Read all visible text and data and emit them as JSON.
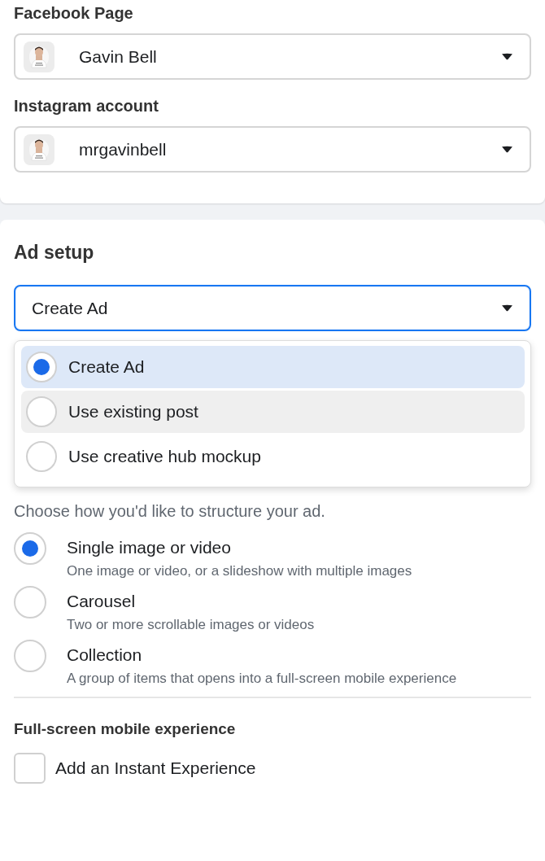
{
  "identity": {
    "fields": [
      {
        "label": "Facebook Page",
        "value": "Gavin Bell"
      },
      {
        "label": "Instagram account",
        "value": "mrgavinbell"
      }
    ]
  },
  "ad_setup": {
    "title": "Ad setup",
    "select": {
      "value": "Create Ad",
      "focused": true
    },
    "menu": {
      "expanded": true,
      "options": [
        {
          "label": "Create Ad",
          "selected": true,
          "hovered": false
        },
        {
          "label": "Use existing post",
          "selected": false,
          "hovered": true
        },
        {
          "label": "Use creative hub mockup",
          "selected": false,
          "hovered": false
        }
      ]
    }
  },
  "format": {
    "description": "Choose how you'd like to structure your ad.",
    "options": [
      {
        "label": "Single image or video",
        "description": "One image or video, or a slideshow with multiple images",
        "selected": true
      },
      {
        "label": "Carousel",
        "description": "Two or more scrollable images or videos",
        "selected": false
      },
      {
        "label": "Collection",
        "description": "A group of items that opens into a full-screen mobile experience",
        "selected": false
      }
    ]
  },
  "mobile_experience": {
    "title": "Full-screen mobile experience",
    "checkbox": {
      "label": "Add an Instant Experience",
      "checked": false
    }
  }
}
